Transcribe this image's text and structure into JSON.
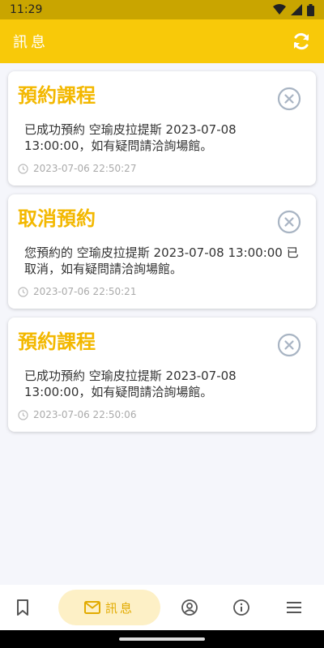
{
  "status_bar": {
    "time": "11:29"
  },
  "app_bar": {
    "title": "訊息",
    "refresh_icon": "refresh-icon"
  },
  "messages": [
    {
      "title": "預約課程",
      "body": "已成功預約 空瑜皮拉提斯 2023-07-08 13:00:00，如有疑問請洽詢場館。",
      "time": "2023-07-06 22:50:27"
    },
    {
      "title": "取消預約",
      "body": "您預約的 空瑜皮拉提斯 2023-07-08 13:00:00 已取消，如有疑問請洽詢場館。",
      "time": "2023-07-06 22:50:21"
    },
    {
      "title": "預約課程",
      "body": "已成功預約 空瑜皮拉提斯 2023-07-08 13:00:00，如有疑問請洽詢場館。",
      "time": "2023-07-06 22:50:06"
    }
  ],
  "bottom_nav": {
    "items": [
      {
        "icon": "bookmark-icon",
        "label": ""
      },
      {
        "icon": "mail-icon",
        "label": "訊息"
      },
      {
        "icon": "account-icon",
        "label": ""
      },
      {
        "icon": "info-icon",
        "label": ""
      },
      {
        "icon": "menu-icon",
        "label": ""
      }
    ]
  },
  "colors": {
    "accent": "#f8c909",
    "title": "#f3b800",
    "status_bar": "#c9a500",
    "nav_active_bg": "#fdf0c6"
  }
}
